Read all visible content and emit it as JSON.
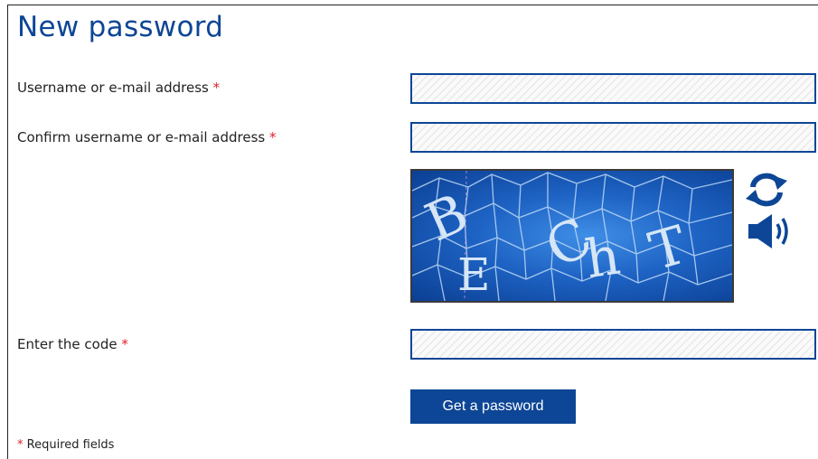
{
  "page": {
    "title": "New password",
    "required_marker": "*"
  },
  "form": {
    "username": {
      "label": "Username or e-mail address",
      "value": ""
    },
    "confirm_username": {
      "label": "Confirm username or e-mail address",
      "value": ""
    },
    "captcha": {
      "code_text": "BECht",
      "characters": [
        "B",
        "E",
        "C",
        "h",
        "T"
      ],
      "refresh_icon": "refresh-icon",
      "audio_icon": "speaker-audio-icon"
    },
    "code": {
      "label": "Enter the code",
      "value": ""
    },
    "submit_label": "Get a password"
  },
  "footer": {
    "required_note": "Required fields"
  },
  "colors": {
    "brand_blue": "#0d4696",
    "required_red": "#e0202a"
  }
}
